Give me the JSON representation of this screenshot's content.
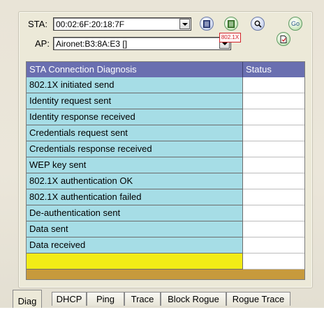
{
  "sta": {
    "label": "STA:",
    "value": "00:02:6F:20:18:7F"
  },
  "ap": {
    "label": "AP:",
    "value": "Aironet:B3:8A:E3 []"
  },
  "toolbar": {
    "go_label": "Go",
    "badge_8021x": "802.1X"
  },
  "table": {
    "headers": [
      "STA Connection Diagnosis",
      "Status"
    ],
    "rows": [
      "802.1X initiated send",
      "Identity request sent",
      "Identity response received",
      "Credentials request sent",
      "Credentials response received",
      "WEP key sent",
      "802.1X authentication OK",
      "802.1X authentication failed",
      "De-authentication sent",
      "Data sent",
      "Data received"
    ],
    "new_row": ""
  },
  "tabs": [
    "Diag",
    "DHCP",
    "Ping",
    "Trace",
    "Block Rogue",
    "Rogue Trace"
  ],
  "active_tab": "Diag",
  "colors": {
    "header": "#6a6fb0",
    "row": "#a6dde6",
    "new_row": "#f2ec16",
    "frame": "#c79a3c"
  }
}
